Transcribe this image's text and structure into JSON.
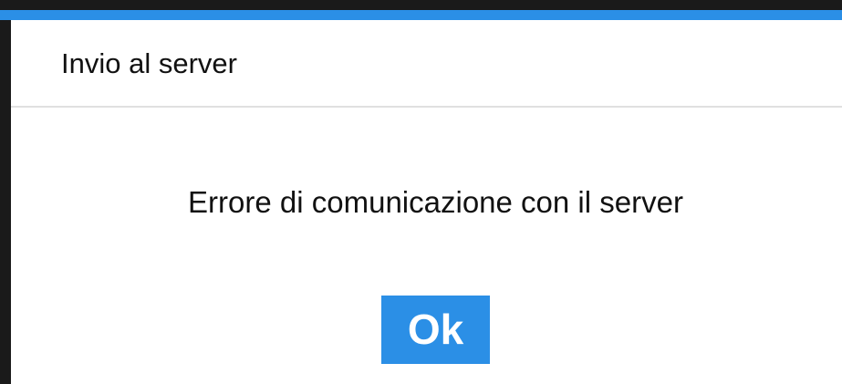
{
  "dialog": {
    "title": "Invio al server",
    "message": "Errore di comunicazione con il server",
    "ok_label": "Ok"
  },
  "colors": {
    "accent": "#2b8fe6",
    "background": "#ffffff",
    "text": "#111111",
    "divider": "#e0e0e0"
  }
}
